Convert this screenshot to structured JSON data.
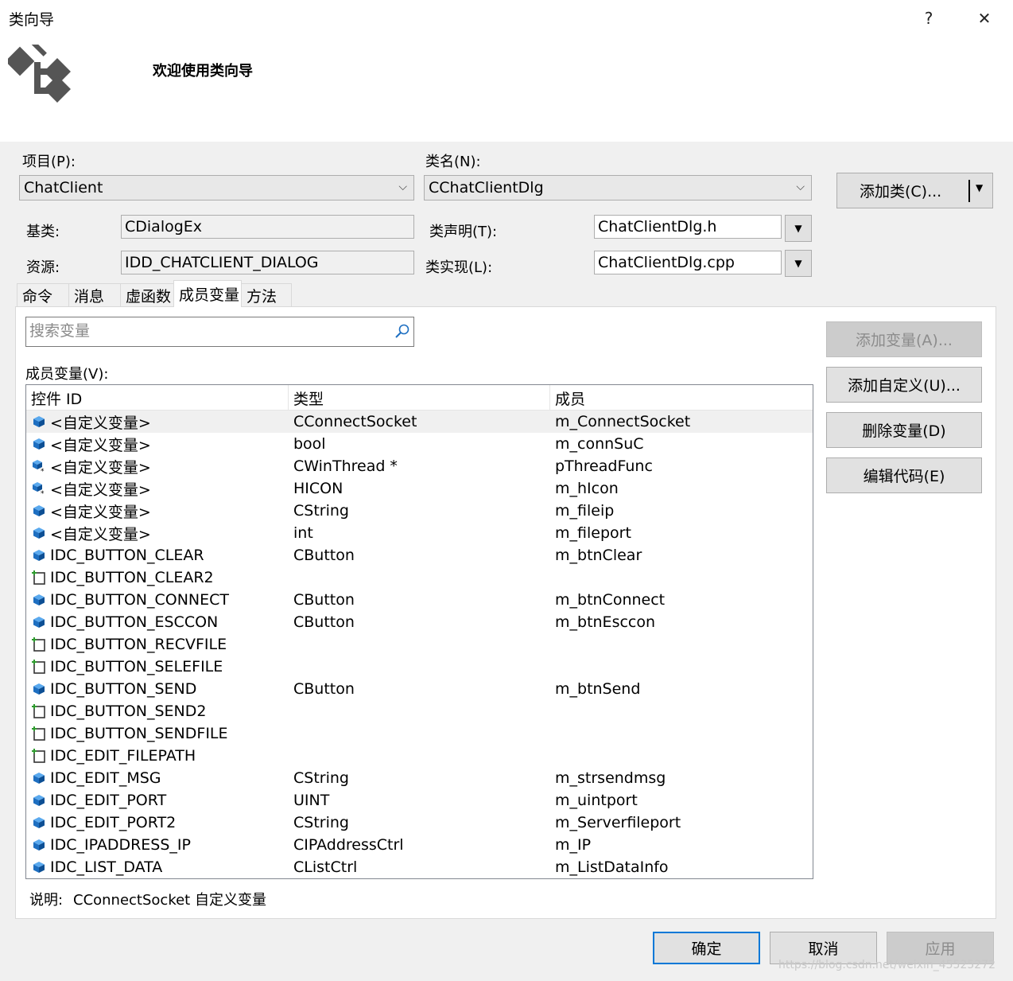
{
  "window": {
    "title": "类向导",
    "help_glyph": "?",
    "close_glyph": "✕",
    "welcome": "欢迎使用类向导"
  },
  "project": {
    "label": "项目(P):",
    "value": "ChatClient"
  },
  "classname": {
    "label": "类名(N):",
    "value": "CChatClientDlg"
  },
  "add_class_button": "添加类(C)...",
  "base_class": {
    "label": "基类:",
    "value": "CDialogEx"
  },
  "resource": {
    "label": "资源:",
    "value": "IDD_CHATCLIENT_DIALOG"
  },
  "class_decl": {
    "label": "类声明(T):",
    "value": "ChatClientDlg.h"
  },
  "class_impl": {
    "label": "类实现(L):",
    "value": "ChatClientDlg.cpp"
  },
  "tabs": [
    "命令",
    "消息",
    "虚函数",
    "成员变量",
    "方法"
  ],
  "active_tab": 3,
  "search": {
    "placeholder": "搜索变量"
  },
  "members_label": "成员变量(V):",
  "columns": [
    "控件 ID",
    "类型",
    "成员"
  ],
  "rows": [
    {
      "icon": "variable-icon",
      "id": "<自定义变量>",
      "type": "CConnectSocket",
      "member": "m_ConnectSocket"
    },
    {
      "icon": "variable-icon",
      "id": "<自定义变量>",
      "type": "bool",
      "member": "m_connSuC"
    },
    {
      "icon": "variable-pointer-icon",
      "id": "<自定义变量>",
      "type": "CWinThread *",
      "member": "pThreadFunc"
    },
    {
      "icon": "variable-pointer-icon",
      "id": "<自定义变量>",
      "type": "HICON",
      "member": "m_hIcon"
    },
    {
      "icon": "variable-icon",
      "id": "<自定义变量>",
      "type": "CString",
      "member": "m_fileip"
    },
    {
      "icon": "variable-icon",
      "id": "<自定义变量>",
      "type": "int",
      "member": "m_fileport"
    },
    {
      "icon": "variable-icon",
      "id": "IDC_BUTTON_CLEAR",
      "type": "CButton",
      "member": "m_btnClear"
    },
    {
      "icon": "control-icon",
      "id": "IDC_BUTTON_CLEAR2",
      "type": "",
      "member": ""
    },
    {
      "icon": "variable-icon",
      "id": "IDC_BUTTON_CONNECT",
      "type": "CButton",
      "member": "m_btnConnect"
    },
    {
      "icon": "variable-icon",
      "id": "IDC_BUTTON_ESCCON",
      "type": "CButton",
      "member": "m_btnEsccon"
    },
    {
      "icon": "control-icon",
      "id": "IDC_BUTTON_RECVFILE",
      "type": "",
      "member": ""
    },
    {
      "icon": "control-icon",
      "id": "IDC_BUTTON_SELEFILE",
      "type": "",
      "member": ""
    },
    {
      "icon": "variable-icon",
      "id": "IDC_BUTTON_SEND",
      "type": "CButton",
      "member": "m_btnSend"
    },
    {
      "icon": "control-icon",
      "id": "IDC_BUTTON_SEND2",
      "type": "",
      "member": ""
    },
    {
      "icon": "control-icon",
      "id": "IDC_BUTTON_SENDFILE",
      "type": "",
      "member": ""
    },
    {
      "icon": "control-icon",
      "id": "IDC_EDIT_FILEPATH",
      "type": "",
      "member": ""
    },
    {
      "icon": "variable-icon",
      "id": "IDC_EDIT_MSG",
      "type": "CString",
      "member": "m_strsendmsg"
    },
    {
      "icon": "variable-icon",
      "id": "IDC_EDIT_PORT",
      "type": "UINT",
      "member": "m_uintport"
    },
    {
      "icon": "variable-icon",
      "id": "IDC_EDIT_PORT2",
      "type": "CString",
      "member": "m_Serverfileport"
    },
    {
      "icon": "variable-icon",
      "id": "IDC_IPADDRESS_IP",
      "type": "CIPAddressCtrl",
      "member": "m_IP"
    },
    {
      "icon": "variable-icon",
      "id": "IDC_LIST_DATA",
      "type": "CListCtrl",
      "member": "m_ListDataInfo"
    }
  ],
  "side_buttons": {
    "add_variable": "添加变量(A)...",
    "add_custom": "添加自定义(U)...",
    "delete_variable": "删除变量(D)",
    "edit_code": "编辑代码(E)"
  },
  "description": {
    "label": "说明:",
    "text": "CConnectSocket 自定义变量"
  },
  "footer_buttons": {
    "ok": "确定",
    "cancel": "取消",
    "apply": "应用"
  },
  "watermark": "https://blog.csdn.net/weixin_45525272",
  "colors": {
    "accent": "#0078d7",
    "variable_icon": "#1e6fc1"
  }
}
